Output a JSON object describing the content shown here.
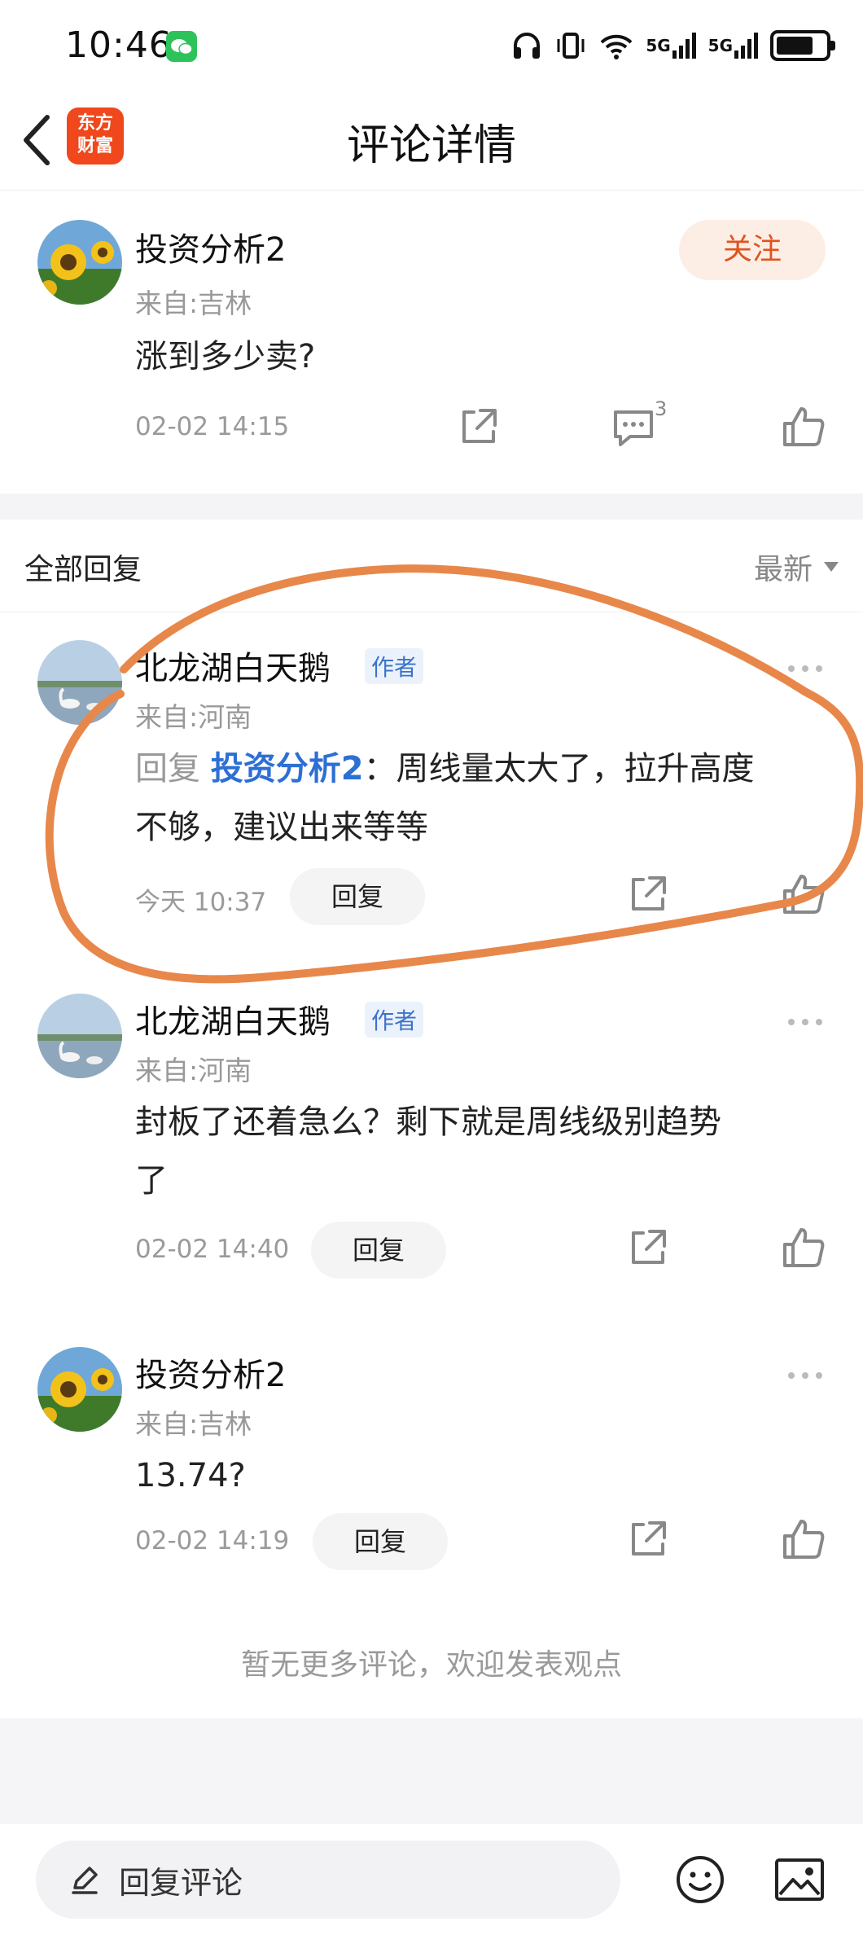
{
  "status_bar": {
    "time": "10:46",
    "network_1": "5G",
    "network_2": "5G",
    "battery_level": 0.75
  },
  "nav": {
    "title": "评论详情",
    "logo_line1": "东方",
    "logo_line2": "财富"
  },
  "main_comment": {
    "author": "投资分析2",
    "location": "来自:吉林",
    "content": "涨到多少卖?",
    "time": "02-02 14:15",
    "comment_count": "3",
    "follow_label": "关注"
  },
  "replies_header": {
    "title": "全部回复",
    "sort_label": "最新"
  },
  "replies": [
    {
      "author": "北龙湖白天鹅",
      "tag": "作者",
      "location": "来自:河南",
      "reply_prefix": "回复 ",
      "reply_target": "投资分析2",
      "content_line1": "：周线量太大了，拉升高度",
      "content_line2": "不够，建议出来等等",
      "time": "今天 10:37",
      "reply_label": "回复"
    },
    {
      "author": "北龙湖白天鹅",
      "tag": "作者",
      "location": "来自:河南",
      "content_line1": "封板了还着急么？剩下就是周线级别趋势",
      "content_line2": "了",
      "time": "02-02 14:40",
      "reply_label": "回复"
    },
    {
      "author": "投资分析2",
      "location": "来自:吉林",
      "content_line1": "13.74?",
      "time": "02-02 14:19",
      "reply_label": "回复"
    }
  ],
  "footer_note": "暂无更多评论，欢迎发表观点",
  "bottom_bar": {
    "input_placeholder": "回复评论"
  },
  "colors": {
    "accent": "#e0531f",
    "link": "#2d6fd4",
    "annotation": "#e8874a"
  }
}
